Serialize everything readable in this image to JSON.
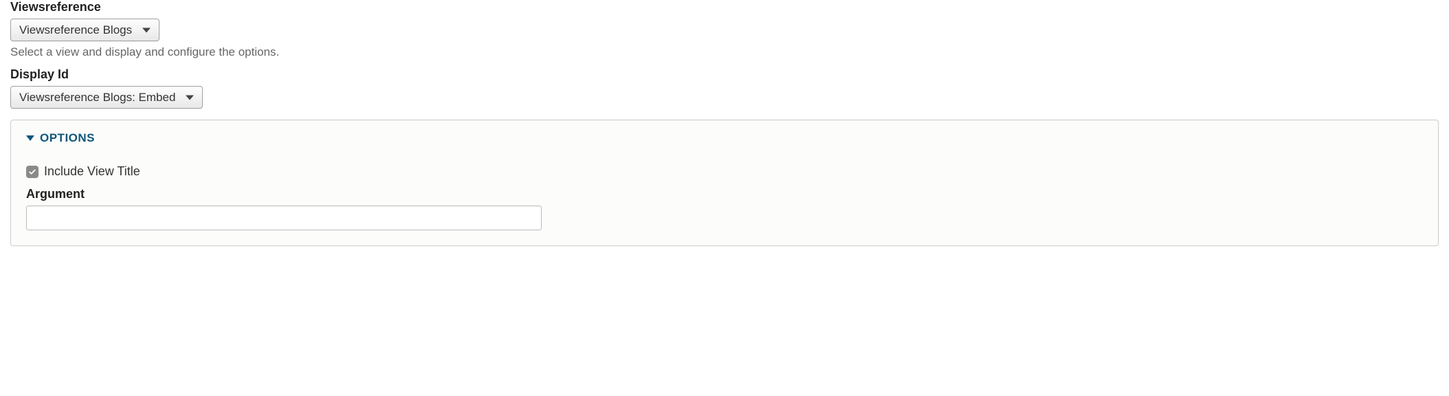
{
  "viewsreference": {
    "label": "Viewsreference",
    "selected": "Viewsreference Blogs",
    "description": "Select a view and display and configure the options."
  },
  "display_id": {
    "label": "Display Id",
    "selected": "Viewsreference Blogs: Embed"
  },
  "options_panel": {
    "legend": "OPTIONS",
    "include_view_title": {
      "label": "Include View Title",
      "checked": true
    },
    "argument": {
      "label": "Argument",
      "value": ""
    }
  }
}
